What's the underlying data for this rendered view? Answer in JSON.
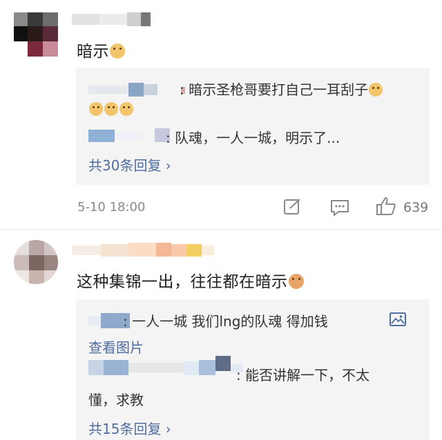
{
  "comments": [
    {
      "text": "暗示",
      "reply_box": {
        "replies": [
          {
            "text": "暗示圣枪哥要打自己一耳刮子"
          },
          {
            "text": "队魂，一人一城，明示了..."
          }
        ],
        "more": "共30条回复 ›"
      },
      "time": "5-10 18:00",
      "likes": "639"
    },
    {
      "text": "这种集锦一出，往往都在暗示",
      "reply_box": {
        "replies": [
          {
            "text": "一人一城  我们lng的队魂   得加钱"
          },
          {
            "link": "查看图片"
          },
          {
            "text": "能否讲解一下，不太",
            "text2": "懂，求教"
          }
        ],
        "more": "共15条回复 ›"
      }
    }
  ],
  "icons": {
    "emoji": "doge-emoji-icon",
    "emoji_cat": "cat-emoji-icon",
    "edit": "repost-icon",
    "comment": "comment-icon",
    "like": "thumbs-up-icon",
    "image": "image-icon"
  }
}
